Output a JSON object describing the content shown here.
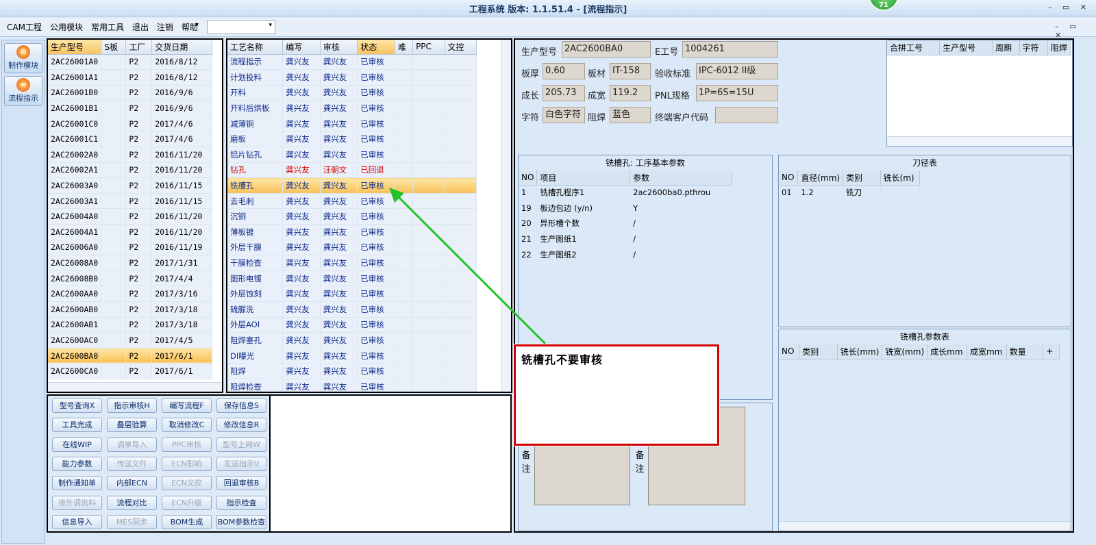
{
  "window": {
    "title": "工程系统  版本: 1.1.51.4 - [流程指示]",
    "badge": "71",
    "controls": "– ▭ ✕"
  },
  "menu": {
    "items": [
      "CAM工程",
      "公用模块",
      "常用工具",
      "退出",
      "注销",
      "帮助"
    ],
    "dropdown_arrow": "▾",
    "combo_value": "",
    "mdi_controls": "– ▭ ✕"
  },
  "rail": {
    "buttons": [
      {
        "label": "制作模块",
        "icon": "gear-icon"
      },
      {
        "label": "流程指示",
        "icon": "flow-icon"
      }
    ]
  },
  "models": {
    "headers": [
      "生产型号",
      "S板",
      "工厂",
      "交货日期"
    ],
    "rows": [
      [
        "2AC26001A0",
        "",
        "P2",
        "2016/8/12"
      ],
      [
        "2AC26001A1",
        "",
        "P2",
        "2016/8/12"
      ],
      [
        "2AC26001B0",
        "",
        "P2",
        "2016/9/6"
      ],
      [
        "2AC26001B1",
        "",
        "P2",
        "2016/9/6"
      ],
      [
        "2AC26001C0",
        "",
        "P2",
        "2017/4/6"
      ],
      [
        "2AC26001C1",
        "",
        "P2",
        "2017/4/6"
      ],
      [
        "2AC26002A0",
        "",
        "P2",
        "2016/11/20"
      ],
      [
        "2AC26002A1",
        "",
        "P2",
        "2016/11/20"
      ],
      [
        "2AC26003A0",
        "",
        "P2",
        "2016/11/15"
      ],
      [
        "2AC26003A1",
        "",
        "P2",
        "2016/11/15"
      ],
      [
        "2AC26004A0",
        "",
        "P2",
        "2016/11/20"
      ],
      [
        "2AC26004A1",
        "",
        "P2",
        "2016/11/20"
      ],
      [
        "2AC26006A0",
        "",
        "P2",
        "2016/11/19"
      ],
      [
        "2AC26008A0",
        "",
        "P2",
        "2017/1/31"
      ],
      [
        "2AC26008B0",
        "",
        "P2",
        "2017/4/4"
      ],
      [
        "2AC2600AA0",
        "",
        "P2",
        "2017/3/16"
      ],
      [
        "2AC2600AB0",
        "",
        "P2",
        "2017/3/18"
      ],
      [
        "2AC2600AB1",
        "",
        "P2",
        "2017/3/18"
      ],
      [
        "2AC2600AC0",
        "",
        "P2",
        "2017/4/5"
      ],
      [
        "2AC2600BA0",
        "",
        "P2",
        "2017/6/1"
      ],
      [
        "2AC2600CA0",
        "",
        "P2",
        "2017/6/1"
      ]
    ],
    "selected_index": 19
  },
  "processes": {
    "headers": [
      "工艺名称",
      "编写",
      "审核",
      "状态",
      "难",
      "PPC",
      "文控"
    ],
    "rows": [
      [
        "流程指示",
        "龚兴友",
        "龚兴友",
        "已审核"
      ],
      [
        "计划投料",
        "龚兴友",
        "龚兴友",
        "已审核"
      ],
      [
        "开料",
        "龚兴友",
        "龚兴友",
        "已审核"
      ],
      [
        "开料后烘板",
        "龚兴友",
        "龚兴友",
        "已审核"
      ],
      [
        "减薄铜",
        "龚兴友",
        "龚兴友",
        "已审核"
      ],
      [
        "磨板",
        "龚兴友",
        "龚兴友",
        "已审核"
      ],
      [
        "铝片钻孔",
        "龚兴友",
        "龚兴友",
        "已审核"
      ],
      [
        "钻孔",
        "龚兴友",
        "汪朝文",
        "已回退"
      ],
      [
        "铣槽孔",
        "龚兴友",
        "龚兴友",
        "已审核"
      ],
      [
        "去毛刺",
        "龚兴友",
        "龚兴友",
        "已审核"
      ],
      [
        "沉铜",
        "龚兴友",
        "龚兴友",
        "已审核"
      ],
      [
        "薄板镀",
        "龚兴友",
        "龚兴友",
        "已审核"
      ],
      [
        "外层干膜",
        "龚兴友",
        "龚兴友",
        "已审核"
      ],
      [
        "干膜检查",
        "龚兴友",
        "龚兴友",
        "已审核"
      ],
      [
        "图形电镀",
        "龚兴友",
        "龚兴友",
        "已审核"
      ],
      [
        "外层蚀刻",
        "龚兴友",
        "龚兴友",
        "已审核"
      ],
      [
        "硫脲洗",
        "龚兴友",
        "龚兴友",
        "已审核"
      ],
      [
        "外层AOI",
        "龚兴友",
        "龚兴友",
        "已审核"
      ],
      [
        "阻焊塞孔",
        "龚兴友",
        "龚兴友",
        "已审核"
      ],
      [
        "DI曝光",
        "龚兴友",
        "龚兴友",
        "已审核"
      ],
      [
        "阻焊",
        "龚兴友",
        "龚兴友",
        "已审核"
      ],
      [
        "阻焊检查",
        "龚兴友",
        "龚兴友",
        "已审核"
      ]
    ],
    "selected_index": 8,
    "rejected_index": 7
  },
  "actions": [
    {
      "label": "型号查询X",
      "enabled": true
    },
    {
      "label": "指示审核H",
      "enabled": true
    },
    {
      "label": "编写流程F",
      "enabled": true
    },
    {
      "label": "保存信息S",
      "enabled": true
    },
    {
      "label": "工具完成",
      "enabled": true
    },
    {
      "label": "叠层验算",
      "enabled": true
    },
    {
      "label": "取消修改C",
      "enabled": true
    },
    {
      "label": "修改信息R",
      "enabled": true
    },
    {
      "label": "在线WIP",
      "enabled": true
    },
    {
      "label": "调单导入",
      "enabled": false
    },
    {
      "label": "PPC审核",
      "enabled": false
    },
    {
      "label": "型号上网W",
      "enabled": false
    },
    {
      "label": "能力参数",
      "enabled": true
    },
    {
      "label": "传送文件",
      "enabled": false
    },
    {
      "label": "ECN影响",
      "enabled": false
    },
    {
      "label": "发送指示V",
      "enabled": false
    },
    {
      "label": "制作通知单",
      "enabled": true
    },
    {
      "label": "内部ECN",
      "enabled": true
    },
    {
      "label": "ECN文控",
      "enabled": false
    },
    {
      "label": "回退审核B",
      "enabled": true
    },
    {
      "label": "接外调资料",
      "enabled": false
    },
    {
      "label": "流程对比",
      "enabled": true
    },
    {
      "label": "ECN升级",
      "enabled": false
    },
    {
      "label": "指示检查",
      "enabled": true
    },
    {
      "label": "信息导入",
      "enabled": true
    },
    {
      "label": "MES同步",
      "enabled": false
    },
    {
      "label": "BOM生成",
      "enabled": true
    },
    {
      "label": "BOM参数检查",
      "enabled": true
    }
  ],
  "info": {
    "model_label": "生产型号",
    "model_value": "2AC2600BA0",
    "e_label": "E工号",
    "e_value": "1004261",
    "thick_label": "板厚",
    "thick_value": "0.60",
    "material_label": "板材",
    "material_value": "IT-158",
    "std_label": "验收标准",
    "std_value": "IPC-6012 II级",
    "len_label": "成长",
    "len_value": "205.73",
    "width_label": "成宽",
    "width_value": "119.2",
    "pnl_label": "PNL规格",
    "pnl_value": "1P=6S=15U",
    "char_label": "字符",
    "char_value": "白色字符",
    "mask_label": "阻焊",
    "mask_value": "蓝色",
    "cust_label": "终端客户代码",
    "cust_value": ""
  },
  "merge_table": {
    "headers": [
      "合拼工号",
      "生产型号",
      "周期",
      "字符",
      "阻焊"
    ]
  },
  "slot_params": {
    "title": "铣槽孔: 工序基本参数",
    "headers": [
      "NO",
      "项目",
      "参数"
    ],
    "rows": [
      [
        "1",
        "铣槽孔程序1",
        "2ac2600ba0.pthrou"
      ],
      [
        "19",
        "板边包边 (y/n)",
        "Y"
      ],
      [
        "20",
        "异形槽个数",
        "/"
      ],
      [
        "21",
        "生产图纸1",
        "/"
      ],
      [
        "22",
        "生产图纸2",
        "/"
      ]
    ]
  },
  "tool_table": {
    "title": "刀径表",
    "headers": [
      "NO",
      "直径(mm)",
      "类别",
      "铣长(m)"
    ],
    "rows": [
      [
        "01",
        "1.2",
        "铣刀",
        ""
      ]
    ]
  },
  "slot_table": {
    "title": "铣槽孔参数表",
    "headers": [
      "NO",
      "类别",
      "铣长(mm)",
      "铣宽(mm)",
      "成长mm",
      "成宽mm",
      "数量",
      "+"
    ]
  },
  "memo": {
    "label1": "备注",
    "label2": "备注"
  },
  "callout": {
    "text": "铣槽孔不要审核"
  },
  "colors": {
    "accent": "#f8c157",
    "arrow": "#22c32a",
    "callout_border": "#d00000",
    "rejected": "#d40000"
  }
}
